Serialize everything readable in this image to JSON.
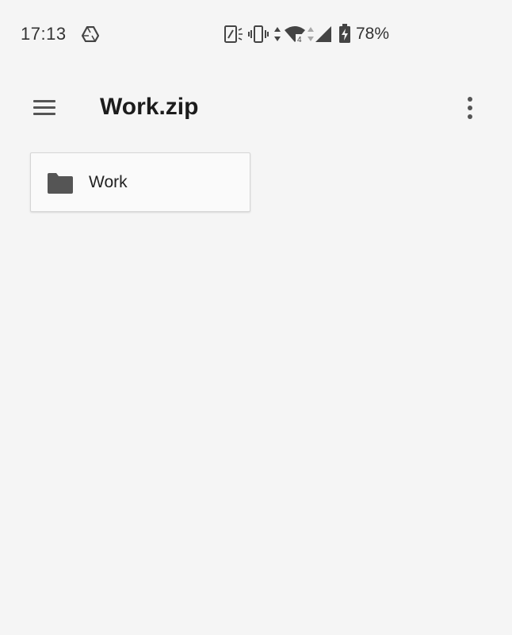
{
  "status_bar": {
    "time": "17:13",
    "battery_percent": "78%",
    "notification_icons": [
      "drive-icon"
    ],
    "system_icons": [
      "nfc-icon",
      "vibrate-icon",
      "data-arrows-icon",
      "wifi-icon",
      "cell-signal-icon",
      "battery-charging-icon"
    ],
    "wifi_badge": "4"
  },
  "app_bar": {
    "title": "Work.zip",
    "menu_icon": "menu-icon",
    "overflow_icon": "more-vert-icon"
  },
  "content": {
    "items": [
      {
        "name": "Work",
        "type": "folder",
        "icon": "folder-icon"
      }
    ]
  },
  "colors": {
    "background": "#f5f5f5",
    "card_background": "#fafafa",
    "icon_gray": "#555555",
    "text": "#1c1c1c"
  }
}
